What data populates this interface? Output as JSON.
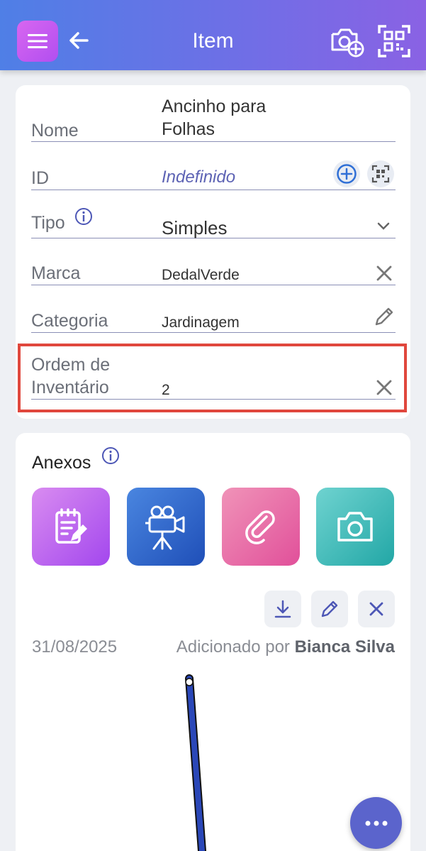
{
  "header": {
    "title": "Item"
  },
  "form": {
    "nome": {
      "label": "Nome",
      "value_line1": "Ancinho para",
      "value_line2": "Folhas"
    },
    "id": {
      "label": "ID",
      "value": "Indefinido"
    },
    "tipo": {
      "label": "Tipo",
      "value": "Simples"
    },
    "marca": {
      "label": "Marca",
      "value": "DedalVerde"
    },
    "categoria": {
      "label": "Categoria",
      "value": "Jardinagem"
    },
    "ordem": {
      "label_line1": "Ordem de",
      "label_line2": "Inventário",
      "value": "2"
    }
  },
  "anexos": {
    "title": "Anexos",
    "date": "31/08/2025",
    "added_by_prefix": "Adicionado por ",
    "added_by_name": "Bianca Silva"
  },
  "icons": [
    "menu-icon",
    "back-arrow-icon",
    "camera-add-icon",
    "qr-scan-icon",
    "info-icon",
    "plus-circle-icon",
    "chevron-down-icon",
    "close-icon",
    "pencil-icon",
    "note-icon",
    "video-camera-icon",
    "paperclip-icon",
    "camera-icon",
    "download-icon",
    "more-icon"
  ],
  "colors": {
    "accent": "#5b64cc",
    "highlight": "#e0473d",
    "link_blue": "#2f6fd6"
  }
}
